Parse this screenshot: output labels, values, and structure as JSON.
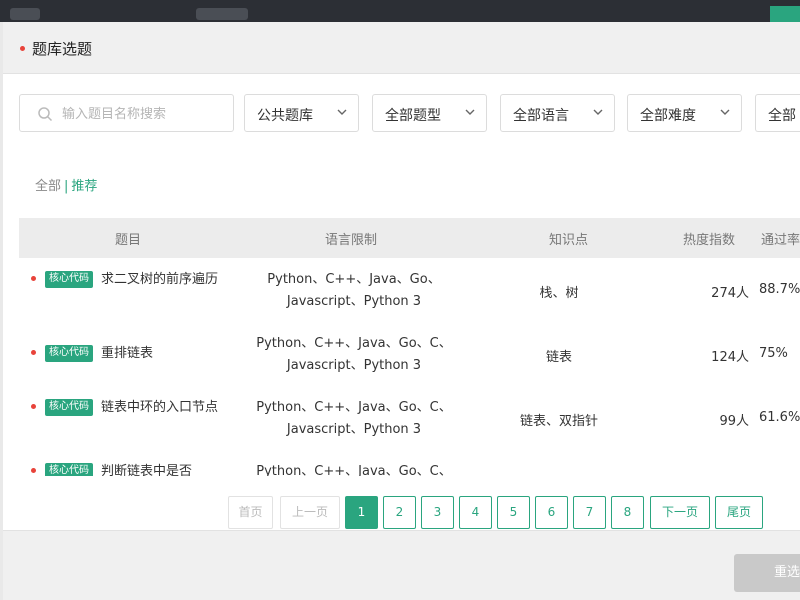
{
  "dialog": {
    "title": "题库选题"
  },
  "search": {
    "placeholder": "输入题目名称搜索"
  },
  "filters": [
    {
      "label": "公共题库"
    },
    {
      "label": "全部题型"
    },
    {
      "label": "全部语言"
    },
    {
      "label": "全部难度"
    },
    {
      "label": "全部"
    }
  ],
  "tabs": {
    "all": "全部",
    "separator": "|",
    "recommend": "推荐"
  },
  "table": {
    "columns": [
      "题目",
      "语言限制",
      "知识点",
      "热度指数",
      "通过率"
    ],
    "rows": [
      {
        "tag": "核心代码",
        "title": "求二叉树的前序遍历",
        "languages": "Python、C++、Java、Go、Javascript、Python 3",
        "knowledge": "栈、树",
        "heat": "274人",
        "pass_rate": "88.7%"
      },
      {
        "tag": "核心代码",
        "title": "重排链表",
        "languages": "Python、C++、Java、Go、C、Javascript、Python 3",
        "knowledge": "链表",
        "heat": "124人",
        "pass_rate": "75%"
      },
      {
        "tag": "核心代码",
        "title": "链表中环的入口节点",
        "languages": "Python、C++、Java、Go、C、Javascript、Python 3",
        "knowledge": "链表、双指针",
        "heat": "99人",
        "pass_rate": "61.6%"
      },
      {
        "tag": "核心代码",
        "title": "判断链表中是否",
        "languages": "Python、C++、Java、Go、C、",
        "knowledge": "",
        "heat": "",
        "pass_rate": ""
      }
    ]
  },
  "pagination": {
    "first": "首页",
    "prev": "上一页",
    "pages": [
      "1",
      "2",
      "3",
      "4",
      "5",
      "6",
      "7",
      "8"
    ],
    "current": "1",
    "next": "下一页",
    "last": "尾页"
  },
  "footer": {
    "confirm_label": "重选"
  },
  "colors": {
    "accent": "#2aa57f",
    "dot": "#e8433a"
  }
}
